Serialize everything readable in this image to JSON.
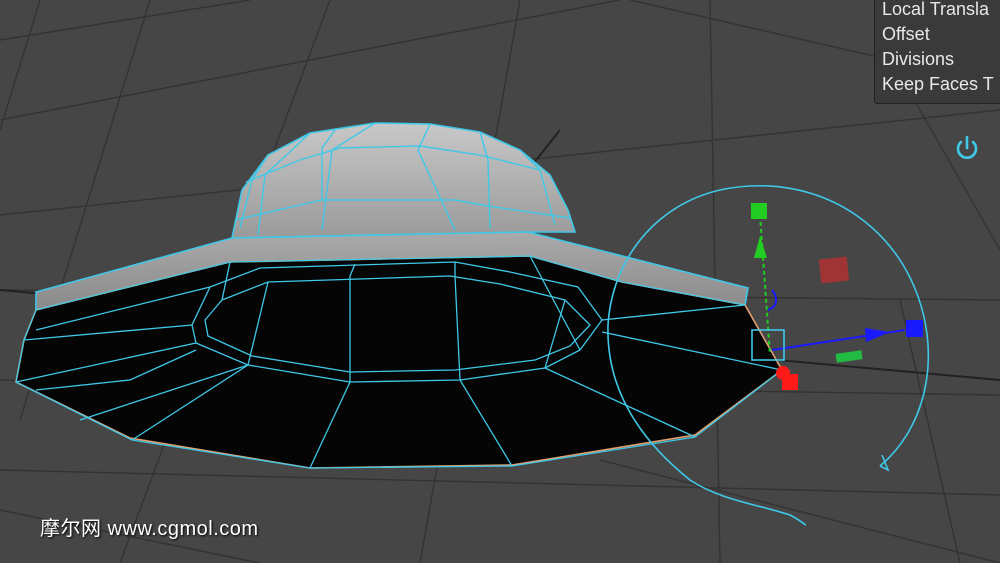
{
  "viewport": {
    "background": "#464646",
    "wireframe_color": "#3fc8e8",
    "outline_color": "#e0a070"
  },
  "attribute_panel": {
    "rows": [
      "Local Transla",
      "Offset",
      "Divisions",
      "Keep Faces T"
    ]
  },
  "icons": {
    "power": "power-icon"
  },
  "manipulator": {
    "axis_x_color": "#1a1aff",
    "axis_y_color": "#22cc22",
    "axis_z_color": "#ff1a1a"
  },
  "watermark": {
    "text": "摩尔网 www.cgmol.com"
  }
}
